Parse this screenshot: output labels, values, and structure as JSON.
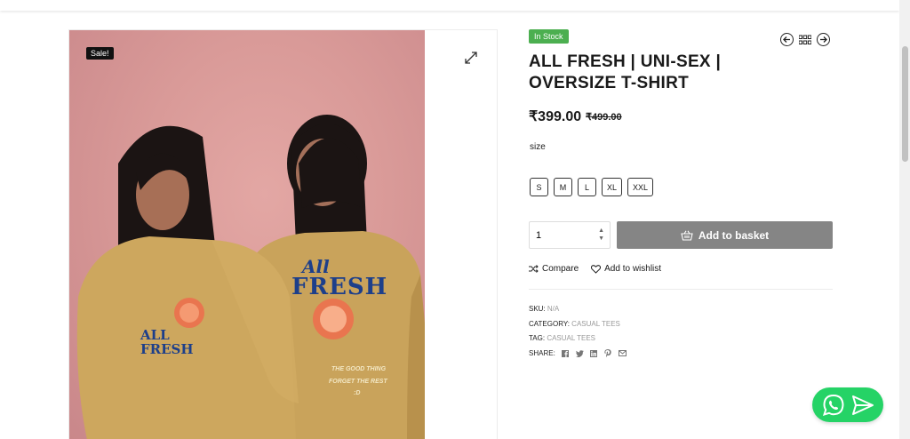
{
  "product": {
    "sale_badge": "Sale!",
    "stock_status": "In Stock",
    "title": "ALL FRESH | UNI-SEX | OVERSIZE T-SHIRT",
    "price": "₹399.00",
    "old_price": "₹499.00",
    "size_label": "size",
    "sizes": [
      "S",
      "M",
      "L",
      "XL",
      "XXL"
    ],
    "quantity": "1",
    "add_to_basket": "Add to basket",
    "compare": "Compare",
    "wishlist": "Add to wishlist",
    "sku_label": "SKU:",
    "sku_value": "N/A",
    "category_label": "CATEGORY:",
    "category_value": "CASUAL TEES",
    "tag_label": "TAG:",
    "tag_value": "CASUAL TEES",
    "share_label": "SHARE:",
    "share_icons": [
      "facebook-icon",
      "twitter-icon",
      "linkedin-icon",
      "pinterest-icon",
      "email-icon"
    ]
  },
  "print": {
    "left_shirt": "ALL FRESH",
    "back_all": "All",
    "back_fresh": "FRESH",
    "back_tagline_1": "THE GOOD THING",
    "back_tagline_2": "FORGET THE REST",
    "back_tagline_3": ":D"
  },
  "colors": {
    "stock": "#4caf50",
    "basket_button": "#858585",
    "whatsapp": "#25d366",
    "backdrop": "#d99a98",
    "shirt": "#c9a35b"
  }
}
